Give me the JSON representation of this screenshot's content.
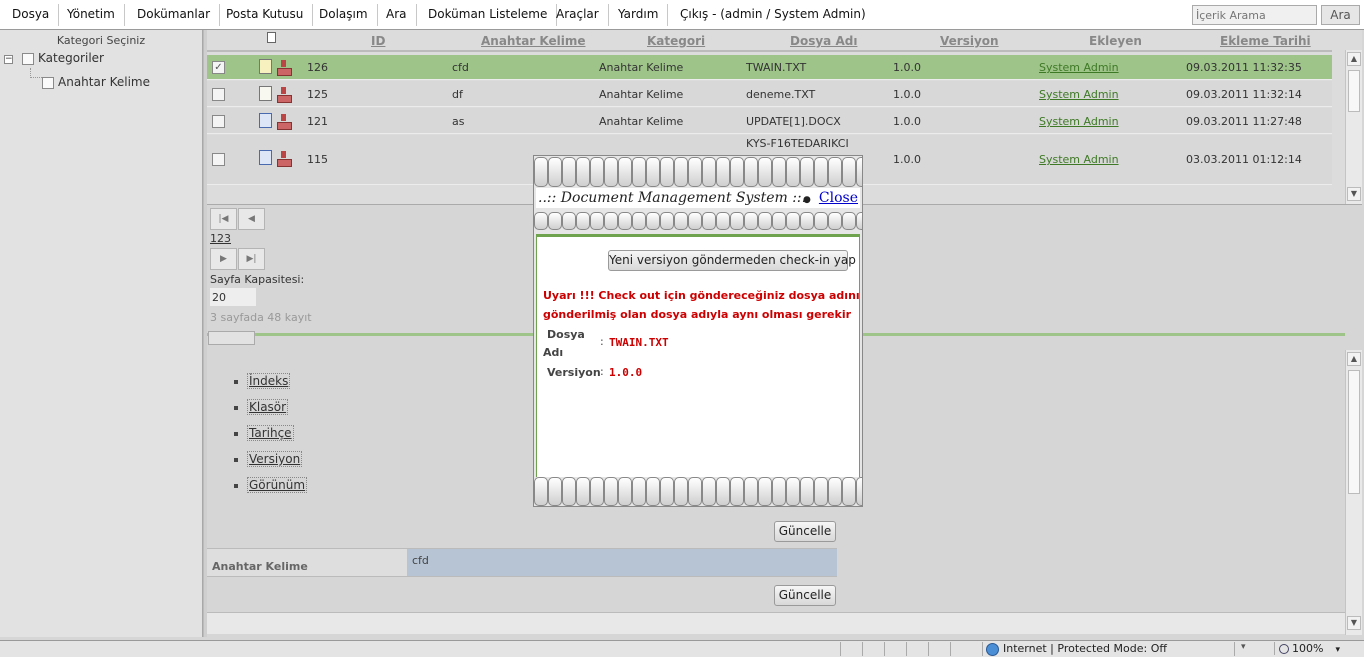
{
  "menu": {
    "items": [
      "Dosya",
      "Yönetim",
      "Dokümanlar",
      "Posta Kutusu",
      "Dolaşım",
      "Ara",
      "Doküman Listeleme",
      "Araçlar",
      "Yardım",
      "Çıkış - (admin / System Admin)"
    ],
    "search_placeholder": "İçerik Arama",
    "search_button": "Ara"
  },
  "tree": {
    "header": "Kategori Seçiniz",
    "root": "Kategoriler",
    "child": "Anahtar Kelime"
  },
  "grid": {
    "columns": [
      "ID",
      "Anahtar Kelime",
      "Kategori",
      "Dosya Adı",
      "Versiyon",
      "Ekleyen",
      "Ekleme Tarihi"
    ],
    "rows": [
      {
        "id": "126",
        "keyword": "cfd",
        "category": "Anahtar Kelime",
        "filename": "TWAIN.TXT",
        "version": "1.0.0",
        "added_by": "System Admin",
        "date": "09.03.2011 11:32:35",
        "checked": true
      },
      {
        "id": "125",
        "keyword": "df",
        "category": "Anahtar Kelime",
        "filename": "deneme.TXT",
        "version": "1.0.0",
        "added_by": "System Admin",
        "date": "09.03.2011 11:32:14",
        "checked": false
      },
      {
        "id": "121",
        "keyword": "as",
        "category": "Anahtar Kelime",
        "filename": "UPDATE[1].DOCX",
        "version": "1.0.0",
        "added_by": "System Admin",
        "date": "09.03.2011 11:27:48",
        "checked": false
      },
      {
        "id": "115",
        "keyword": "",
        "category": "",
        "filename": "KYS-F16TEDARIKCI",
        "version": "1.0.0",
        "added_by": "System Admin",
        "date": "03.03.2011 01:12:14",
        "checked": false
      }
    ]
  },
  "pager": {
    "page_numbers": "123",
    "page_size_label": "Sayfa Kapasitesi:",
    "page_size_value": "20",
    "info": "3 sayfada 48 kayıt"
  },
  "detail": {
    "nav": [
      "İndeks",
      "Klasör",
      "Tarihçe",
      "Versiyon",
      "Görünüm"
    ],
    "update_button": "Güncelle",
    "keyword_label": "Anahtar Kelime",
    "keyword_value": "cfd"
  },
  "modal": {
    "title": "..:: Document Management System ::..",
    "close": "Close",
    "checkin_button": "Yeni versiyon göndermeden check-in yap",
    "warning_line1": "Uyarı !!! Check out için göndereceğiniz dosya adının, daha önce",
    "warning_line2": "gönderilmiş olan dosya adıyla aynı olması gerekir",
    "field1_label_a": "Dosya",
    "field1_label_b": "Adı",
    "field1_value": "TWAIN.TXT",
    "field2_label": "Versiyon",
    "field2_value": "1.0.0"
  },
  "status": {
    "zone": "Internet | Protected Mode: Off",
    "zoom": "100%"
  },
  "icons": [
    "folder-tree-icon",
    "document-icon",
    "download-icon",
    "word-doc-icon",
    "globe-icon",
    "zoom-icon",
    "checkbox-icon"
  ]
}
